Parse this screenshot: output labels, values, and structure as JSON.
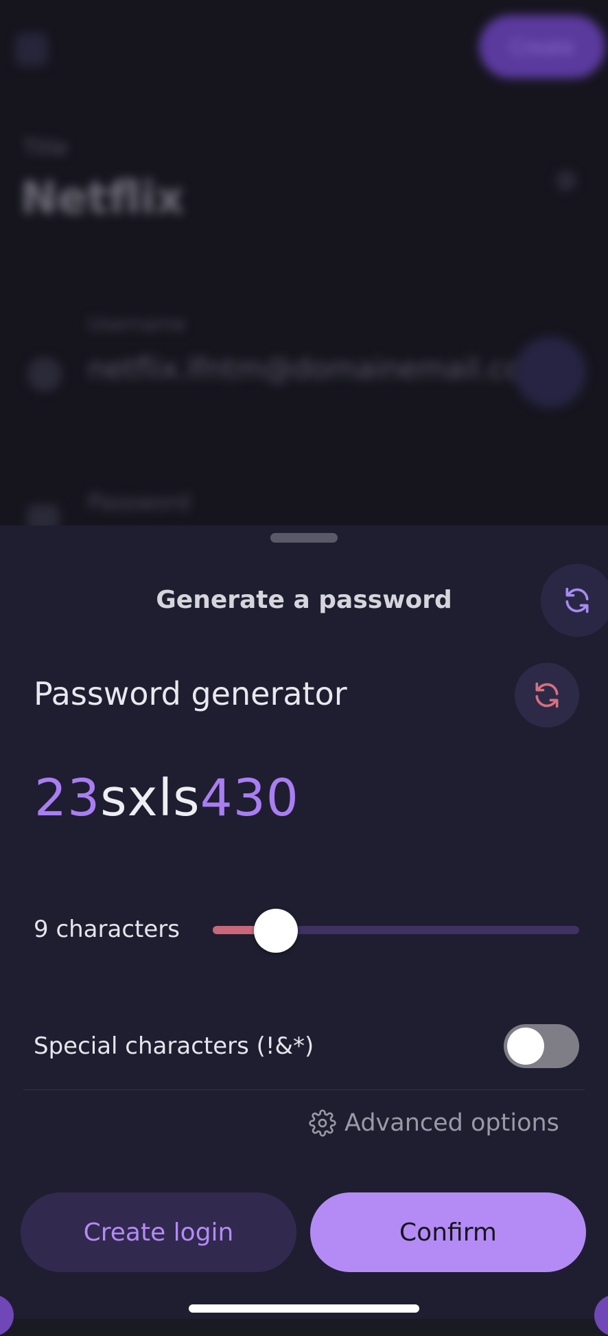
{
  "background": {
    "action_label": "Create",
    "kicker": "Title",
    "title": "Netflix",
    "username_label": "Username",
    "username_value": "netflix.lfntm@domainemail.com",
    "password_label": "Password"
  },
  "sheet": {
    "title": "Generate a password",
    "section_title": "Password generator",
    "password_parts": [
      {
        "text": "23",
        "kind": "number"
      },
      {
        "text": "sxls",
        "kind": "letter"
      },
      {
        "text": "430",
        "kind": "number"
      }
    ],
    "length_label": "9 characters",
    "length_slider": {
      "value": 9,
      "min": 4,
      "max": 64
    },
    "special_label": "Special characters (!&*)",
    "special_enabled": false,
    "advanced_label": "Advanced options",
    "create_login_label": "Create login",
    "confirm_label": "Confirm"
  },
  "colors": {
    "accent": "#b48bf5",
    "number_highlight": "#a97ef2",
    "slider_fill": "#c8687a",
    "regen_icon_sheet": "#a58cf0",
    "regen_icon_generator": "#d9707e"
  },
  "icons": {
    "sheet_regen": "refresh-icon",
    "generator_regen": "refresh-icon",
    "advanced": "gear-icon"
  }
}
